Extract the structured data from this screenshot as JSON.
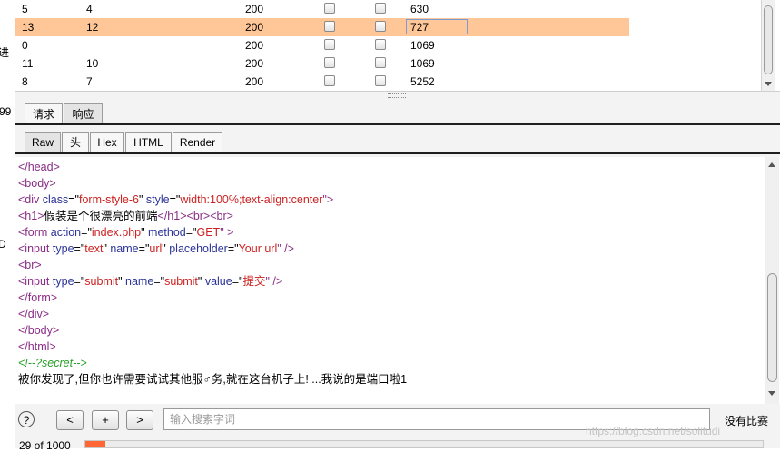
{
  "left_panel": {
    "fragments": [
      "进",
      "99",
      "D"
    ]
  },
  "table": {
    "rows": [
      {
        "request": "5",
        "payload": "4",
        "status": "200",
        "length": "630",
        "selected": false
      },
      {
        "request": "13",
        "payload": "12",
        "status": "200",
        "length": "727",
        "selected": true
      },
      {
        "request": "0",
        "payload": "",
        "status": "200",
        "length": "1069",
        "selected": false
      },
      {
        "request": "11",
        "payload": "10",
        "status": "200",
        "length": "1069",
        "selected": false
      },
      {
        "request": "8",
        "payload": "7",
        "status": "200",
        "length": "5252",
        "selected": false
      }
    ]
  },
  "req_resp_tabs": [
    {
      "label": "请求",
      "active": false
    },
    {
      "label": "响应",
      "active": true
    }
  ],
  "view_tabs": [
    {
      "label": "Raw",
      "active": true
    },
    {
      "label": "头",
      "active": false
    },
    {
      "label": "Hex",
      "active": false
    },
    {
      "label": "HTML",
      "active": false
    },
    {
      "label": "Render",
      "active": false
    }
  ],
  "editor": {
    "lines": [
      [
        {
          "t": "</head>",
          "c": "tg"
        }
      ],
      [
        {
          "t": "<body>",
          "c": "tg"
        }
      ],
      [
        {
          "t": "<div ",
          "c": "tg"
        },
        {
          "t": "class",
          "c": "an"
        },
        {
          "t": "=\"",
          "c": "tx"
        },
        {
          "t": "form-style-6",
          "c": "av"
        },
        {
          "t": "\" ",
          "c": "tx"
        },
        {
          "t": "style",
          "c": "an"
        },
        {
          "t": "=\"",
          "c": "tx"
        },
        {
          "t": "width:100%;text-align:center",
          "c": "av"
        },
        {
          "t": "\">",
          "c": "tg"
        }
      ],
      [
        {
          "t": "<h1>",
          "c": "tg"
        },
        {
          "t": "假装是个很漂亮的前端",
          "c": "tx"
        },
        {
          "t": "</h1>",
          "c": "tg"
        },
        {
          "t": "<br>",
          "c": "tg"
        },
        {
          "t": "<br>",
          "c": "tg"
        }
      ],
      [
        {
          "t": "<form ",
          "c": "tg"
        },
        {
          "t": "action",
          "c": "an"
        },
        {
          "t": "=\"",
          "c": "tx"
        },
        {
          "t": "index.php",
          "c": "av"
        },
        {
          "t": "\" ",
          "c": "tx"
        },
        {
          "t": "method",
          "c": "an"
        },
        {
          "t": "=\"",
          "c": "tx"
        },
        {
          "t": "GET",
          "c": "av"
        },
        {
          "t": "\" >",
          "c": "tg"
        }
      ],
      [
        {
          "t": "<input ",
          "c": "tg"
        },
        {
          "t": "type",
          "c": "an"
        },
        {
          "t": "=\"",
          "c": "tx"
        },
        {
          "t": "text",
          "c": "av"
        },
        {
          "t": "\" ",
          "c": "tx"
        },
        {
          "t": "name",
          "c": "an"
        },
        {
          "t": "=\"",
          "c": "tx"
        },
        {
          "t": "url",
          "c": "av"
        },
        {
          "t": "\" ",
          "c": "tx"
        },
        {
          "t": "placeholder",
          "c": "an"
        },
        {
          "t": "=\"",
          "c": "tx"
        },
        {
          "t": "Your url",
          "c": "av"
        },
        {
          "t": "\" />",
          "c": "tg"
        }
      ],
      [
        {
          "t": "<br>",
          "c": "tg"
        }
      ],
      [
        {
          "t": "<input ",
          "c": "tg"
        },
        {
          "t": "type",
          "c": "an"
        },
        {
          "t": "=\"",
          "c": "tx"
        },
        {
          "t": "submit",
          "c": "av"
        },
        {
          "t": "\" ",
          "c": "tx"
        },
        {
          "t": "name",
          "c": "an"
        },
        {
          "t": "=\"",
          "c": "tx"
        },
        {
          "t": "submit",
          "c": "av"
        },
        {
          "t": "\" ",
          "c": "tx"
        },
        {
          "t": "value",
          "c": "an"
        },
        {
          "t": "=\"",
          "c": "tx"
        },
        {
          "t": "提交",
          "c": "av"
        },
        {
          "t": "\" />",
          "c": "tg"
        }
      ],
      [
        {
          "t": "</form>",
          "c": "tg"
        }
      ],
      [
        {
          "t": "</div>",
          "c": "tg"
        }
      ],
      [
        {
          "t": "</body>",
          "c": "tg"
        }
      ],
      [
        {
          "t": "</html>",
          "c": "tg"
        }
      ],
      [
        {
          "t": "<!--?secret-->",
          "c": "cm"
        }
      ],
      [
        {
          "t": "被你发现了,但你也许需要试试其他服♂务,就在这台机子上! ...我说的是端口啦1",
          "c": "tx"
        }
      ]
    ]
  },
  "bottom": {
    "help": "?",
    "prev": "<",
    "add": "+",
    "next": ">",
    "search_placeholder": "输入搜索字词",
    "no_match": "没有比赛",
    "count": "29 of 1000",
    "watermark": "https://blog.csdn.net/solitudi",
    "progress_fraction": 0.029
  },
  "colors": {
    "selected_row": "#ffc697",
    "progress": "#ff6633"
  }
}
